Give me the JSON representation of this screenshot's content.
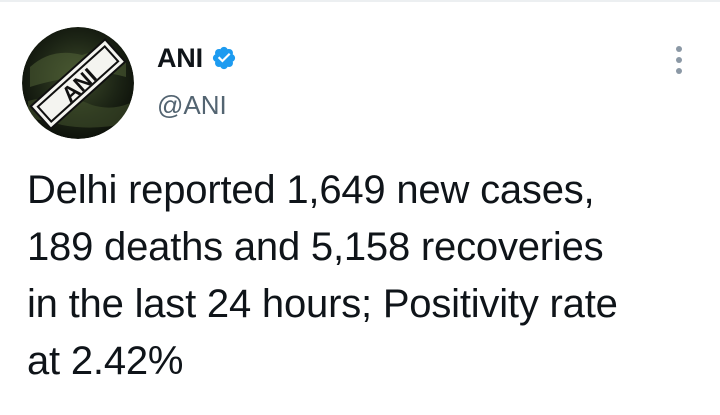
{
  "author": {
    "display_name": "ANI",
    "handle": "@ANI",
    "verified": true,
    "avatar_logo_text": "ANI"
  },
  "tweet": {
    "text": "Delhi reported 1,649 new cases,\n189 deaths and 5,158 recoveries\nin the last 24 hours; Positivity rate\nat 2.42%"
  },
  "icons": {
    "verified": "verified-badge-icon",
    "more": "more-options-icon"
  },
  "colors": {
    "verified_blue": "#1d9bf0",
    "text": "#0f1419",
    "secondary_text": "#536471"
  }
}
